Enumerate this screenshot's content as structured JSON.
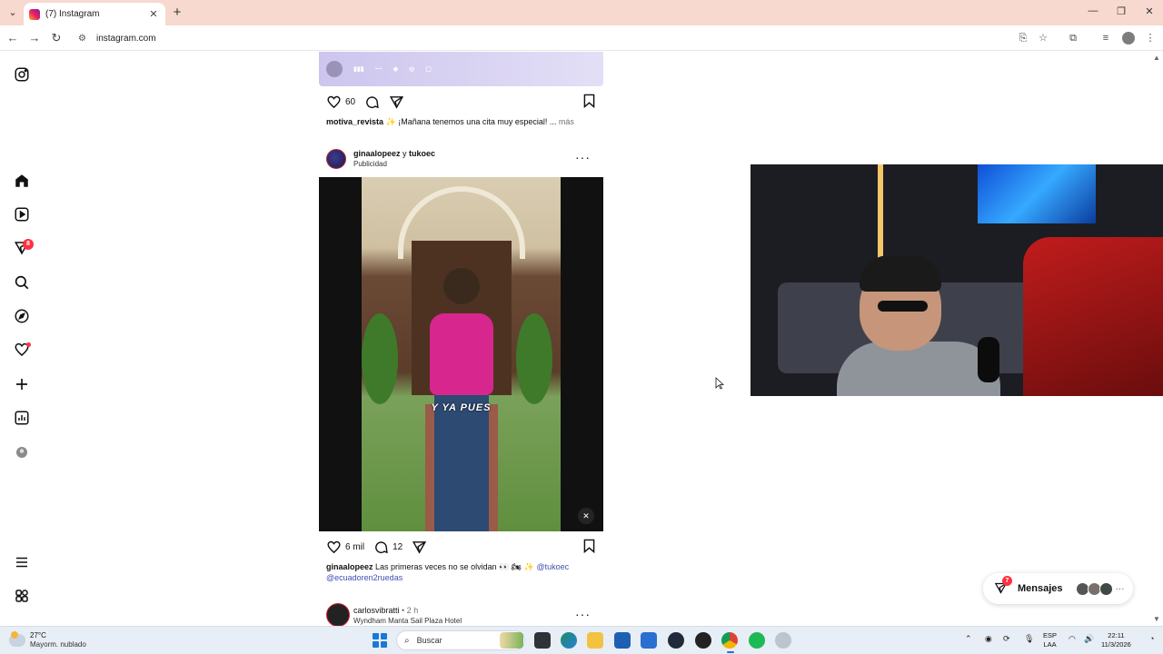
{
  "browser": {
    "tab_title": "(7) Instagram",
    "url": "instagram.com"
  },
  "sidebar": {
    "notifications_badge": "8",
    "items": [
      "instagram-logo",
      "home",
      "reels",
      "messages",
      "search",
      "explore",
      "notifications",
      "create",
      "dashboard",
      "profile",
      "more",
      "also-from-meta"
    ]
  },
  "feed": {
    "post1": {
      "likes": "60",
      "username": "motiva_revista",
      "caption": "✨ ¡Mañana tenemos una cita muy especial! ...",
      "more": "más"
    },
    "post2": {
      "user1": "ginaalopeez",
      "conj": "y",
      "user2": "tukoec",
      "sponsored": "Publicidad",
      "video_caption": "Y YA PUES",
      "likes": "6 mil",
      "comments": "12",
      "caption_user": "ginaalopeez",
      "caption_text": "Las primeras veces no se olvidan 👀 🏍 ✨",
      "mention1": "@tukoec",
      "mention2": "@ecuadoren2ruedas"
    },
    "post3": {
      "username": "carlosvibratti",
      "time": "• 2 h",
      "location": "Wyndham Manta Sail Plaza Hotel"
    }
  },
  "messages_widget": {
    "label": "Mensajes",
    "badge": "7"
  },
  "taskbar": {
    "temperature": "27°C",
    "weather": "Mayorm. nublado",
    "search_placeholder": "Buscar",
    "lang_top": "ESP",
    "lang_bottom": "LAA",
    "time": "22:11",
    "date": "11/3/2026"
  }
}
